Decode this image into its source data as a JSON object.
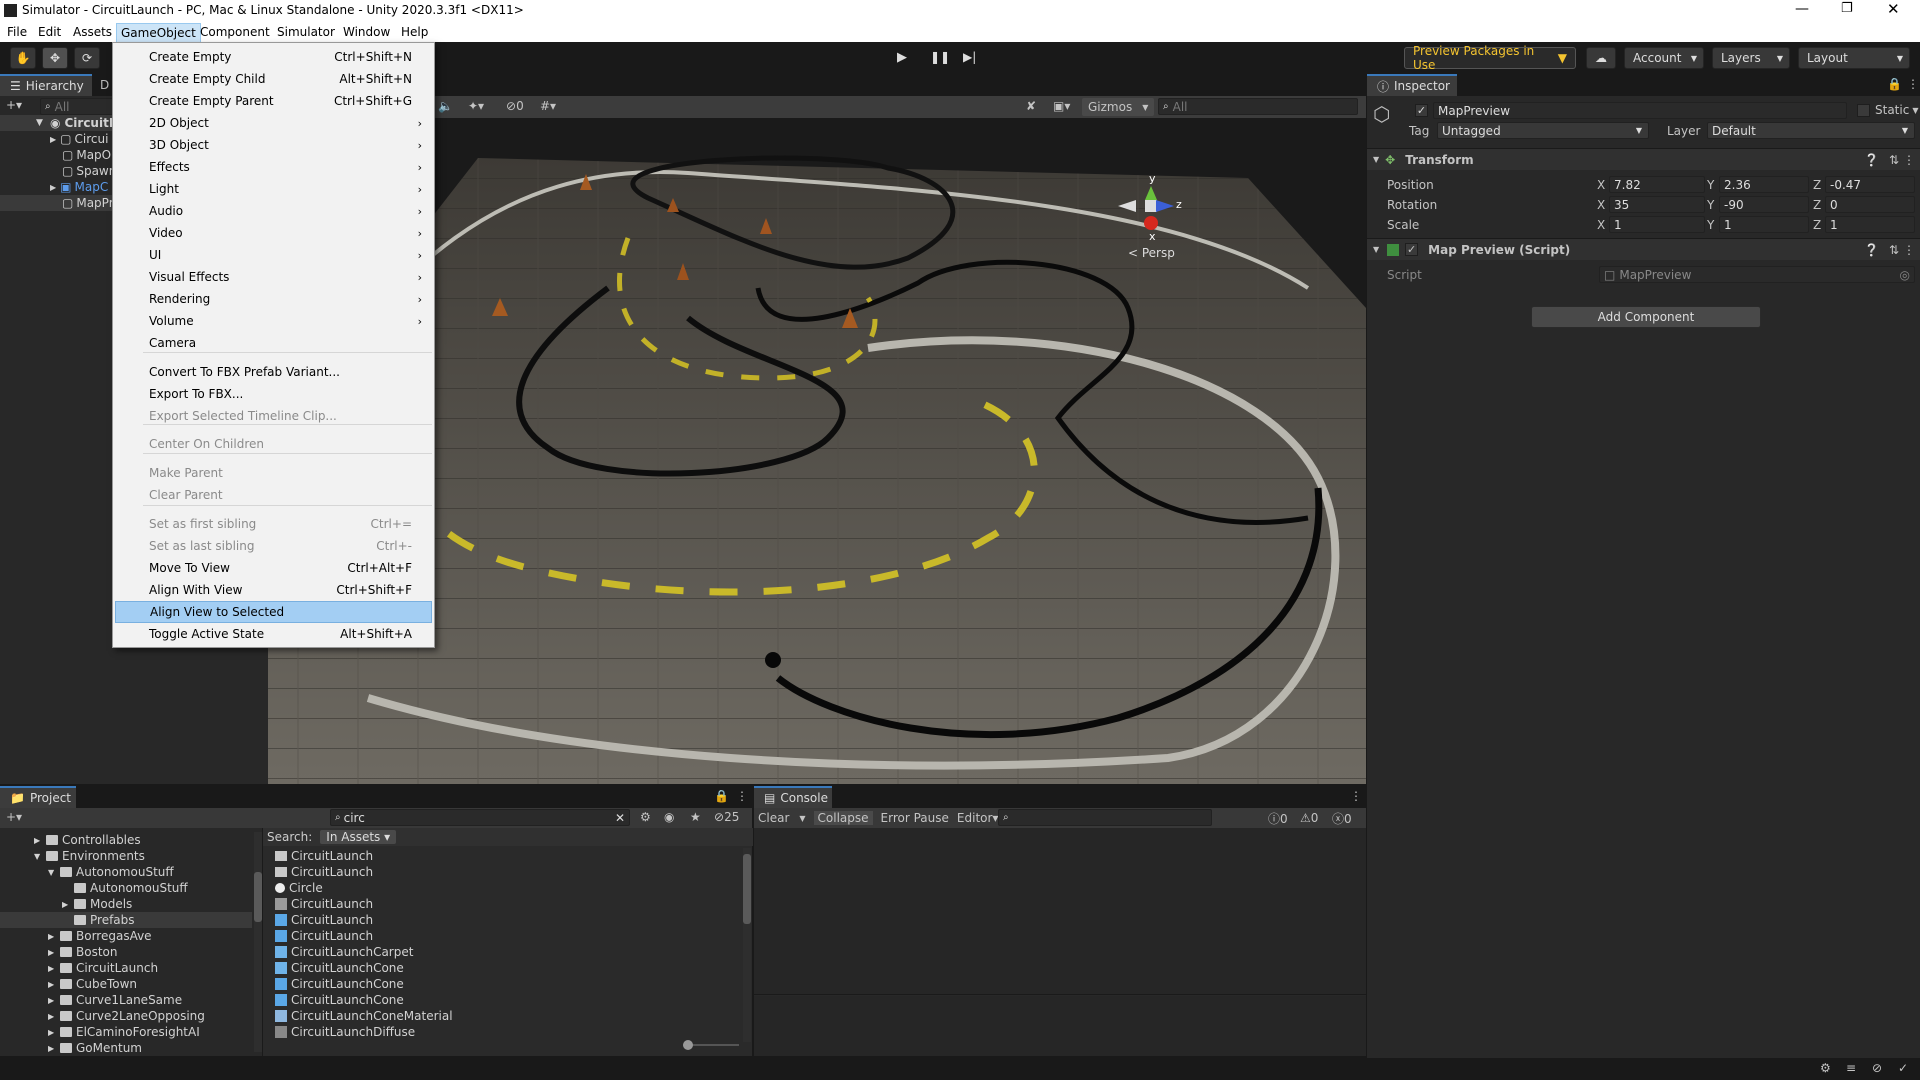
{
  "window": {
    "title": "Simulator - CircuitLaunch - PC, Mac & Linux Standalone - Unity 2020.3.3f1 <DX11>"
  },
  "menubar": [
    "File",
    "Edit",
    "Assets",
    "GameObject",
    "Component",
    "Simulator",
    "Window",
    "Help"
  ],
  "toolbar": {
    "preview_packages": "Preview Packages in Use",
    "account": "Account",
    "layers": "Layers",
    "layout": "Layout"
  },
  "hierarchy": {
    "tab": "Hierarchy",
    "tab2": "D",
    "search_placeholder": "All",
    "items": [
      "CircuitLa",
      "Circui",
      "MapO",
      "Spawn",
      "MapC",
      "MapPr"
    ]
  },
  "scene": {
    "gizmos": "Gizmos",
    "search_placeholder": "All",
    "hidden_count": "0",
    "persp": "< Persp",
    "axes": {
      "y": "y",
      "x": "x",
      "z": "z"
    }
  },
  "menu": {
    "items": [
      {
        "label": "Create Empty",
        "shortcut": "Ctrl+Shift+N"
      },
      {
        "label": "Create Empty Child",
        "shortcut": "Alt+Shift+N"
      },
      {
        "label": "Create Empty Parent",
        "shortcut": "Ctrl+Shift+G"
      },
      {
        "label": "2D Object",
        "sub": true
      },
      {
        "label": "3D Object",
        "sub": true
      },
      {
        "label": "Effects",
        "sub": true
      },
      {
        "label": "Light",
        "sub": true
      },
      {
        "label": "Audio",
        "sub": true
      },
      {
        "label": "Video",
        "sub": true
      },
      {
        "label": "UI",
        "sub": true
      },
      {
        "label": "Visual Effects",
        "sub": true
      },
      {
        "label": "Rendering",
        "sub": true
      },
      {
        "label": "Volume",
        "sub": true
      },
      {
        "label": "Camera"
      },
      {
        "label": "Convert To FBX Prefab Variant..."
      },
      {
        "label": "Export To FBX..."
      },
      {
        "label": "Export Selected Timeline Clip...",
        "disabled": true
      },
      {
        "label": "Center On Children",
        "disabled": true
      },
      {
        "label": "Make Parent",
        "disabled": true
      },
      {
        "label": "Clear Parent",
        "disabled": true
      },
      {
        "label": "Set as first sibling",
        "shortcut": "Ctrl+=",
        "disabled": true
      },
      {
        "label": "Set as last sibling",
        "shortcut": "Ctrl+-",
        "disabled": true
      },
      {
        "label": "Move To View",
        "shortcut": "Ctrl+Alt+F"
      },
      {
        "label": "Align With View",
        "shortcut": "Ctrl+Shift+F"
      },
      {
        "label": "Align View to Selected",
        "highlighted": true
      },
      {
        "label": "Toggle Active State",
        "shortcut": "Alt+Shift+A"
      }
    ]
  },
  "inspector": {
    "tab": "Inspector",
    "object_name": "MapPreview",
    "static": "Static",
    "tag_label": "Tag",
    "tag": "Untagged",
    "layer_label": "Layer",
    "layer": "Default",
    "transform": {
      "title": "Transform",
      "position": {
        "label": "Position",
        "x": "7.82",
        "y": "2.36",
        "z": "-0.47"
      },
      "rotation": {
        "label": "Rotation",
        "x": "35",
        "y": "-90",
        "z": "0"
      },
      "scale": {
        "label": "Scale",
        "x": "1",
        "y": "1",
        "z": "1"
      }
    },
    "script_comp": {
      "title": "Map Preview (Script)",
      "script_label": "Script",
      "script_value": "MapPreview"
    },
    "add_component": "Add Component",
    "axis_x": "X",
    "axis_y": "Y",
    "axis_z": "Z"
  },
  "project": {
    "tab": "Project",
    "search_value": "circ",
    "hidden_count": "25",
    "search_label": "Search:",
    "scope": "In Assets",
    "tree": [
      {
        "label": "Controllables",
        "indent": 1,
        "arrow": "▶"
      },
      {
        "label": "Environments",
        "indent": 1,
        "arrow": "▼"
      },
      {
        "label": "AutonomouStuff",
        "indent": 2,
        "arrow": "▼"
      },
      {
        "label": "AutonomouStuff",
        "indent": 3,
        "arrow": ""
      },
      {
        "label": "Models",
        "indent": 3,
        "arrow": "▶"
      },
      {
        "label": "Prefabs",
        "indent": 3,
        "arrow": "",
        "selected": true
      },
      {
        "label": "BorregasAve",
        "indent": 2,
        "arrow": "▶"
      },
      {
        "label": "Boston",
        "indent": 2,
        "arrow": "▶"
      },
      {
        "label": "CircuitLaunch",
        "indent": 2,
        "arrow": "▶"
      },
      {
        "label": "CubeTown",
        "indent": 2,
        "arrow": "▶"
      },
      {
        "label": "Curve1LaneSame",
        "indent": 2,
        "arrow": "▶"
      },
      {
        "label": "Curve2LaneOpposing",
        "indent": 2,
        "arrow": "▶"
      },
      {
        "label": "ElCaminoForesightAI",
        "indent": 2,
        "arrow": "▶"
      },
      {
        "label": "GoMentum",
        "indent": 2,
        "arrow": "▶"
      }
    ],
    "results": [
      {
        "label": "CircuitLaunch",
        "icon": "folder"
      },
      {
        "label": "CircuitLaunch",
        "icon": "folder"
      },
      {
        "label": "Circle",
        "icon": "circle"
      },
      {
        "label": "CircuitLaunch",
        "icon": "scene"
      },
      {
        "label": "CircuitLaunch",
        "icon": "prefab"
      },
      {
        "label": "CircuitLaunch",
        "icon": "prefab"
      },
      {
        "label": "CircuitLaunchCarpet",
        "icon": "grid"
      },
      {
        "label": "CircuitLaunchCone",
        "icon": "grid"
      },
      {
        "label": "CircuitLaunchCone",
        "icon": "prefab"
      },
      {
        "label": "CircuitLaunchCone",
        "icon": "prefab"
      },
      {
        "label": "CircuitLaunchConeMaterial",
        "icon": "material"
      },
      {
        "label": "CircuitLaunchDiffuse",
        "icon": "texture"
      }
    ]
  },
  "console": {
    "tab": "Console",
    "clear": "Clear",
    "collapse": "Collapse",
    "error_pause": "Error Pause",
    "editor": "Editor",
    "count_log": "0",
    "count_warn": "0",
    "count_err": "0"
  }
}
